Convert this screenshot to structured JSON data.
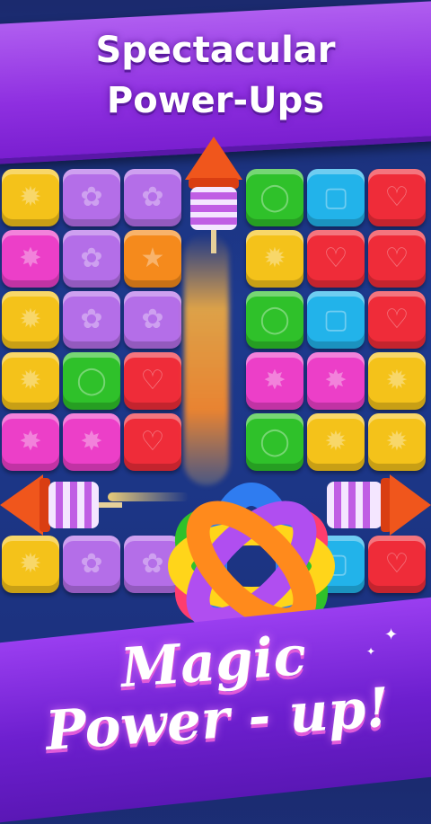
{
  "banner": {
    "line1": "Spectacular",
    "line2": "Power-Ups"
  },
  "footer": {
    "line1": "Magic",
    "line2": "Power - up!"
  },
  "colors": {
    "yellow": "#f4c21a",
    "purple": "#b46ee8",
    "green": "#2fc12a",
    "blue": "#22b3ea",
    "red": "#ef2c39",
    "pink": "#ec3fc8",
    "orange": "#f58a1c"
  },
  "grid": [
    [
      "yellow",
      "purple",
      "purple",
      "",
      "green",
      "blue",
      "red"
    ],
    [
      "pink",
      "purple",
      "orange",
      "",
      "yellow",
      "red",
      "red"
    ],
    [
      "yellow",
      "purple",
      "purple",
      "",
      "green",
      "blue",
      "red"
    ],
    [
      "yellow",
      "green",
      "red",
      "",
      "pink",
      "pink",
      "yellow"
    ],
    [
      "pink",
      "pink",
      "red",
      "",
      "green",
      "yellow",
      "yellow"
    ],
    [
      "",
      "",
      "",
      "",
      "",
      "",
      ""
    ],
    [
      "yellow",
      "purple",
      "purple",
      "",
      "",
      "blue",
      "red"
    ]
  ],
  "emblems": {
    "yellow": "✹",
    "purple": "✿",
    "green": "◯",
    "blue": "▢",
    "red": "♡",
    "pink": "✸",
    "orange": "★"
  }
}
